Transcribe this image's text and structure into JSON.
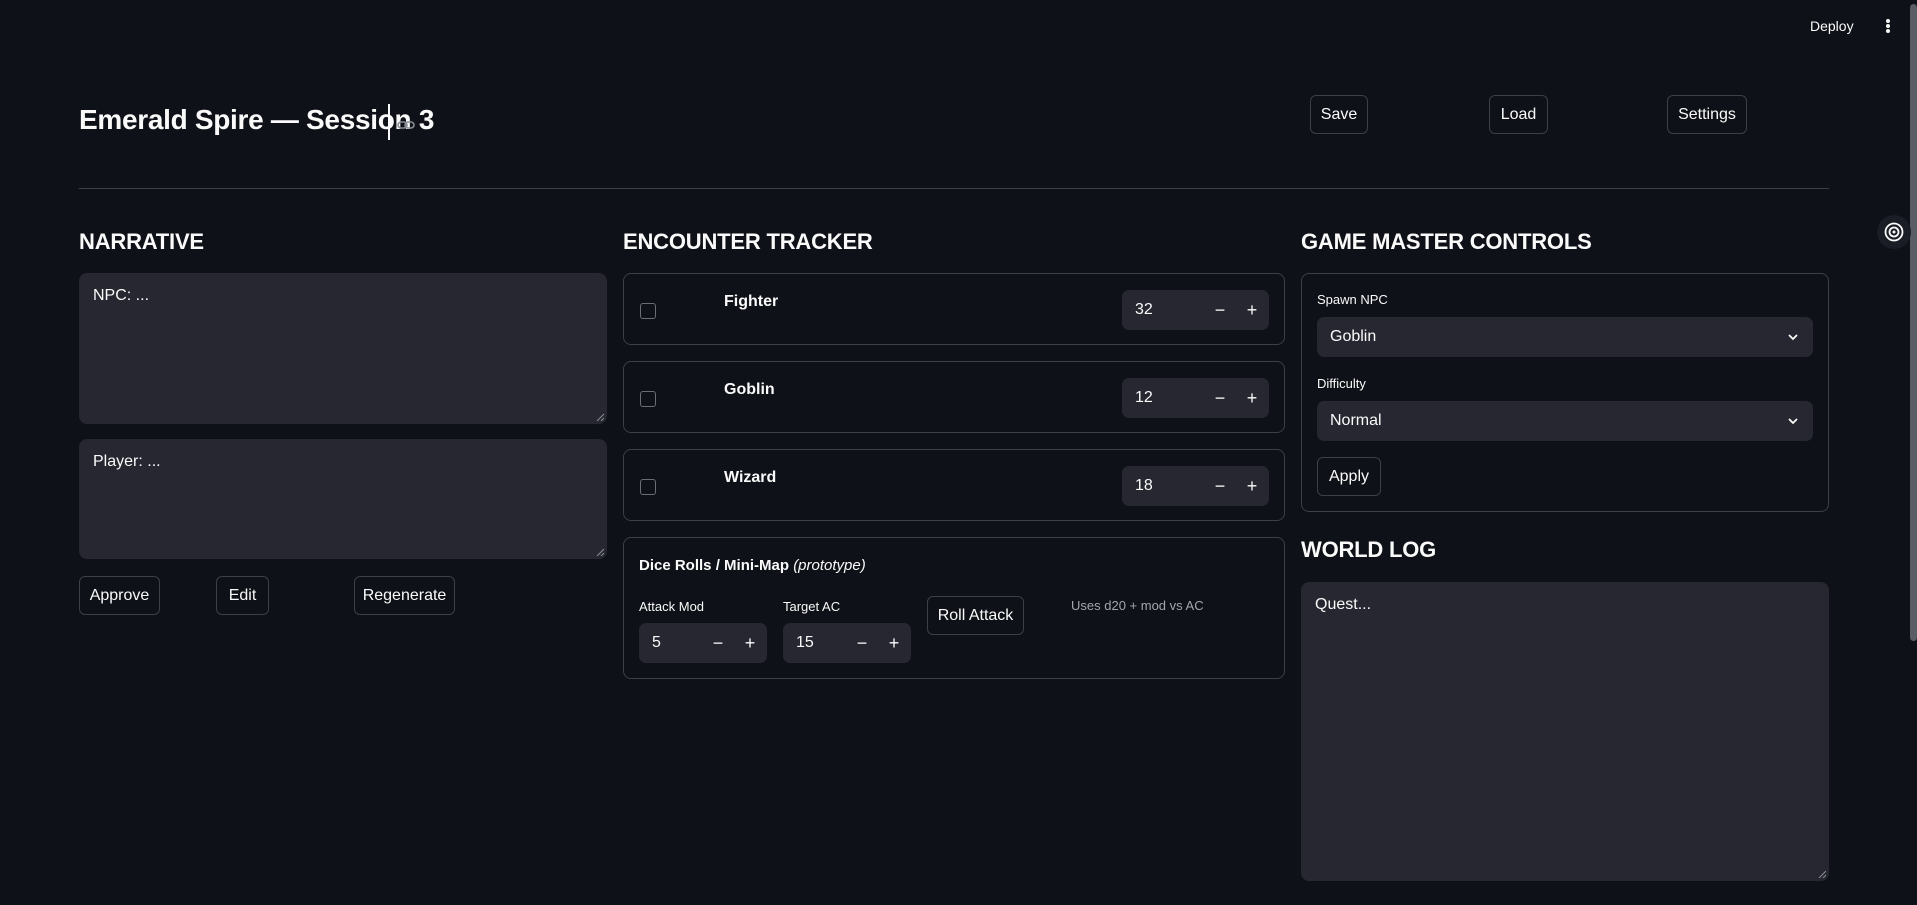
{
  "toolbar": {
    "deploy_label": "Deploy",
    "menu_icon": "kebab-menu-icon"
  },
  "header": {
    "title": "Emerald Spire — Session 3",
    "link_icon": "link-icon",
    "buttons": {
      "save": "Save",
      "load": "Load",
      "settings": "Settings"
    }
  },
  "narrative": {
    "heading": "NARRATIVE",
    "npc_text": "NPC: ...",
    "player_text": "Player: ...",
    "buttons": {
      "approve": "Approve",
      "edit": "Edit",
      "regenerate": "Regenerate"
    }
  },
  "encounter": {
    "heading": "ENCOUNTER TRACKER",
    "combatants": [
      {
        "name": "Fighter",
        "hp": "32",
        "checked": false
      },
      {
        "name": "Goblin",
        "hp": "12",
        "checked": false
      },
      {
        "name": "Wizard",
        "hp": "18",
        "checked": false
      }
    ],
    "dice": {
      "title": "Dice Rolls / Mini-Map",
      "title_suffix": "(prototype)",
      "attack_mod_label": "Attack Mod",
      "attack_mod_value": "5",
      "target_ac_label": "Target AC",
      "target_ac_value": "15",
      "roll_button": "Roll Attack",
      "hint": "Uses d20 + mod vs AC"
    }
  },
  "gm": {
    "heading": "GAME MASTER CONTROLS",
    "spawn_label": "Spawn NPC",
    "spawn_value": "Goblin",
    "difficulty_label": "Difficulty",
    "difficulty_value": "Normal",
    "apply_button": "Apply"
  },
  "world_log": {
    "heading": "WORLD LOG",
    "text": "Quest..."
  },
  "colors": {
    "background": "#0e1117",
    "surface": "#262730",
    "border": "#3b3f4a",
    "text": "#fafafa"
  }
}
